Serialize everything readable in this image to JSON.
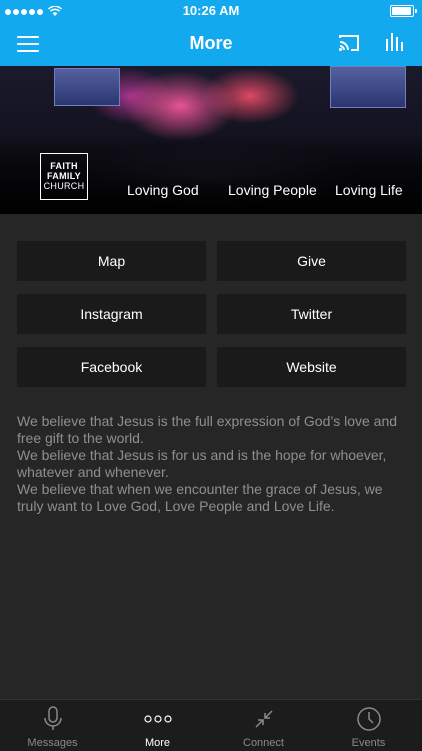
{
  "status_bar": {
    "time": "10:26 AM"
  },
  "header": {
    "title": "More"
  },
  "hero": {
    "logo_lines": [
      "FAITH",
      "FAMILY",
      "CHURCH"
    ],
    "taglines": [
      "Loving God",
      "Loving People",
      "Loving Life"
    ]
  },
  "buttons": [
    {
      "label": "Map"
    },
    {
      "label": "Give"
    },
    {
      "label": "Instagram"
    },
    {
      "label": "Twitter"
    },
    {
      "label": "Facebook"
    },
    {
      "label": "Website"
    }
  ],
  "description": [
    "We believe that Jesus is the full expression of God’s love and free gift to the world.",
    "We believe that Jesus is for us and is the hope for whoever, whatever and whenever.",
    "We believe that when we encounter the grace of Jesus, we truly want to Love God, Love People and Love Life."
  ],
  "tabs": [
    {
      "label": "Messages",
      "icon": "microphone-icon"
    },
    {
      "label": "More",
      "icon": "more-dots-icon",
      "active": true
    },
    {
      "label": "Connect",
      "icon": "connect-arrows-icon"
    },
    {
      "label": "Events",
      "icon": "clock-icon"
    }
  ],
  "colors": {
    "accent": "#12a9ee",
    "background": "#262626",
    "button": "#1a1a1a"
  }
}
